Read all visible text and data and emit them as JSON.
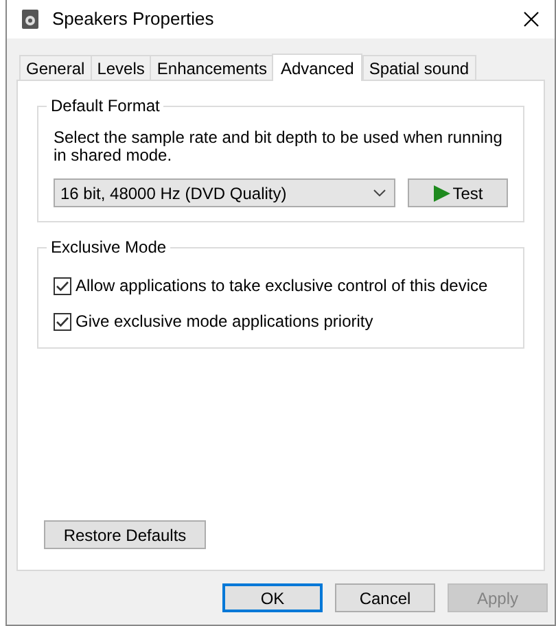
{
  "window": {
    "title": "Speakers Properties"
  },
  "tabs": [
    {
      "label": "General",
      "selected": false
    },
    {
      "label": "Levels",
      "selected": false
    },
    {
      "label": "Enhancements",
      "selected": false
    },
    {
      "label": "Advanced",
      "selected": true
    },
    {
      "label": "Spatial sound",
      "selected": false
    }
  ],
  "default_format": {
    "title": "Default Format",
    "description": "Select the sample rate and bit depth to be used when running in shared mode.",
    "format_value": "16 bit, 48000 Hz (DVD Quality)",
    "test_button": "Test"
  },
  "exclusive_mode": {
    "title": "Exclusive Mode",
    "options": [
      {
        "label": "Allow applications to take exclusive control of this device",
        "checked": true
      },
      {
        "label": "Give exclusive mode applications priority",
        "checked": true
      }
    ]
  },
  "restore_button": "Restore Defaults",
  "buttons": [
    {
      "label": "OK",
      "default": true,
      "disabled": false
    },
    {
      "label": "Cancel",
      "default": false,
      "disabled": false
    },
    {
      "label": "Apply",
      "default": false,
      "disabled": true
    }
  ]
}
